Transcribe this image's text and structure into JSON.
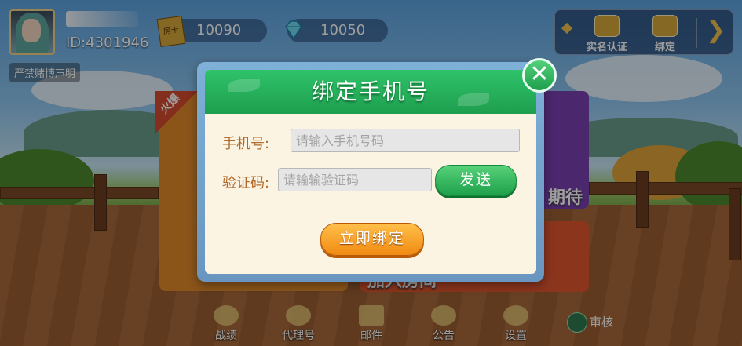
{
  "user": {
    "id_text": "ID:4301946",
    "disclaimer": "严禁赌博声明"
  },
  "currency": {
    "room_card_icon": "房卡",
    "room_cards": "10090",
    "diamonds": "10050"
  },
  "toolbar": {
    "realname_label": "实名认证",
    "bind_label": "绑定"
  },
  "background": {
    "partial_text_right": "期待",
    "partial_text_bottom": "加入房间",
    "hot_badge": "火爆"
  },
  "dialog": {
    "title": "绑定手机号",
    "phone_label": "手机号:",
    "phone_placeholder": "请输入手机号码",
    "code_label": "验证码:",
    "code_placeholder": "请输输验证码",
    "send_label": "发送",
    "bind_now_label": "立即绑定",
    "close_icon": "✕"
  },
  "nav": {
    "items": [
      {
        "label": "战绩"
      },
      {
        "label": "代理号"
      },
      {
        "label": "邮件"
      },
      {
        "label": "公告"
      },
      {
        "label": "设置"
      }
    ],
    "review_label": "审核"
  },
  "colors": {
    "accent_green": "#1e9e4e",
    "accent_orange": "#f08a12",
    "label_brown": "#b06a2a"
  }
}
